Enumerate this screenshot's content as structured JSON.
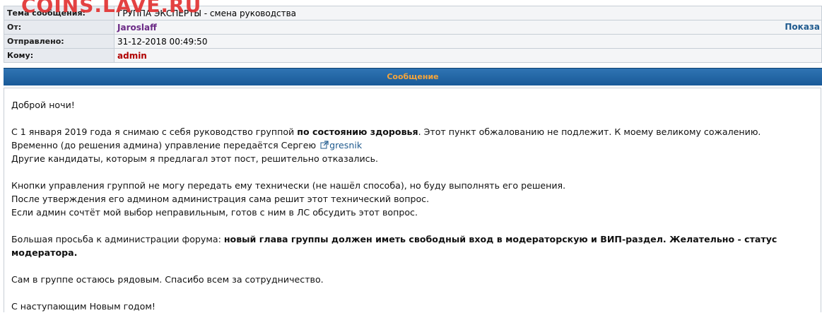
{
  "watermark": "COINS.LAVE.RU",
  "header": {
    "subject_label": "Тема сообщения:",
    "subject_value": "ГРУППА ЭКСПЕРТЫ - смена руководства",
    "from_label": "От:",
    "from_value": "Jaroslaff",
    "show_link": "Показа",
    "sent_label": "Отправлено:",
    "sent_value": "31-12-2018 00:49:50",
    "to_label": "Кому:",
    "to_value": "admin"
  },
  "message": {
    "heading": "Сообщение",
    "greeting": "Доброй ночи!",
    "p1_a": "С 1 января 2019 года я снимаю с себя руководство группой ",
    "p1_bold": "по состоянию здоровья",
    "p1_b": ". Этот пункт обжалованию не подлежит. К моему великому сожалению.",
    "p2_a": "Временно (до решения админа) управление передаётся Сергею ",
    "p2_user": "gresnik",
    "p3": "Другие кандидаты, которым я предлагал этот пост, решительно отказались.",
    "p4": "Кнопки управления группой не могу передать ему технически (не нашёл способа), но буду выполнять его решения.",
    "p5": "После утверждения его админом администрация сама решит этот технический вопрос.",
    "p6": "Если админ сочтёт мой выбор неправильным, готов с ним в ЛС обсудить этот вопрос.",
    "p7_a": "Большая просьба к администрации форума: ",
    "p7_bold": "новый глава группы должен иметь свободный вход в модераторскую и ВИП-раздел. Желательно - статус модератора.",
    "p8": "Сам в группе остаюсь рядовым. Спасибо всем за сотрудничество.",
    "p9": "С наступающим Новым годом!"
  },
  "colors": {
    "header_bar": "#2f74b3",
    "header_text": "#f6a53a",
    "from_name": "#6b2a86",
    "to_name": "#b00000",
    "link": "#1f5a8e"
  }
}
